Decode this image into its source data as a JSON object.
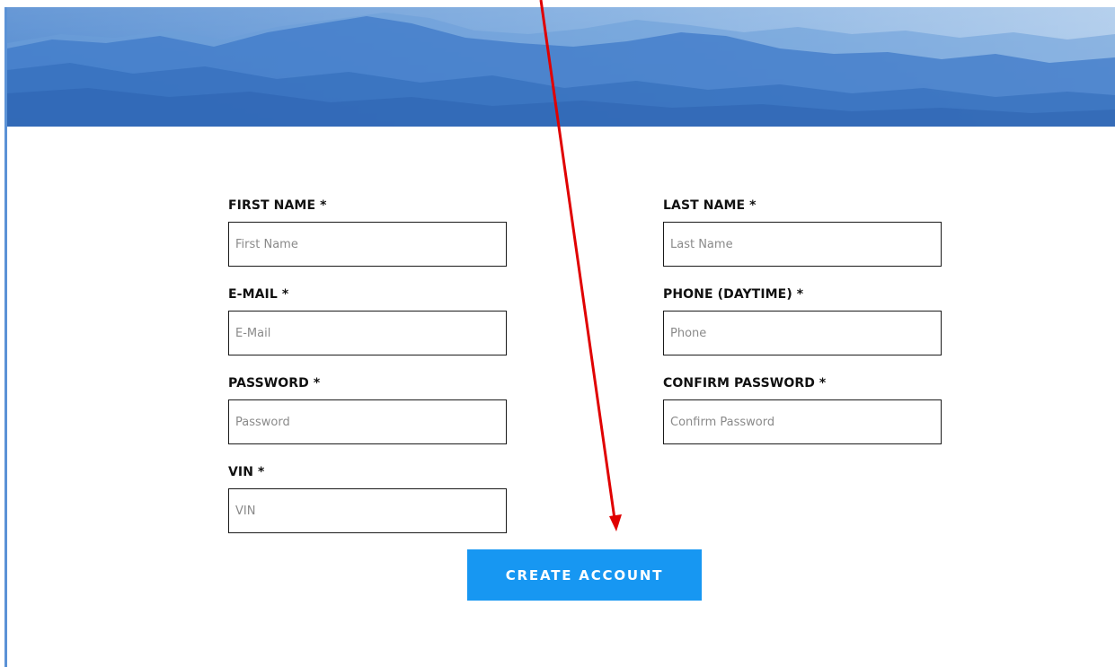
{
  "form": {
    "fields": {
      "first_name": {
        "label": "FIRST NAME *",
        "placeholder": "First Name"
      },
      "last_name": {
        "label": "LAST NAME *",
        "placeholder": "Last Name"
      },
      "email": {
        "label": "E-MAIL *",
        "placeholder": "E-Mail"
      },
      "phone": {
        "label": "PHONE (DAYTIME) *",
        "placeholder": "Phone"
      },
      "password": {
        "label": "PASSWORD *",
        "placeholder": "Password"
      },
      "confirm_password": {
        "label": "CONFIRM PASSWORD *",
        "placeholder": "Confirm Password"
      },
      "vin": {
        "label": "VIN *",
        "placeholder": "VIN"
      }
    },
    "submit_label": "CREATE ACCOUNT"
  },
  "colors": {
    "button": "#1797f2",
    "annotation_arrow": "#e00000",
    "left_rule": "#5b92d6"
  },
  "icons": {
    "annotation": "red-arrow-icon"
  }
}
